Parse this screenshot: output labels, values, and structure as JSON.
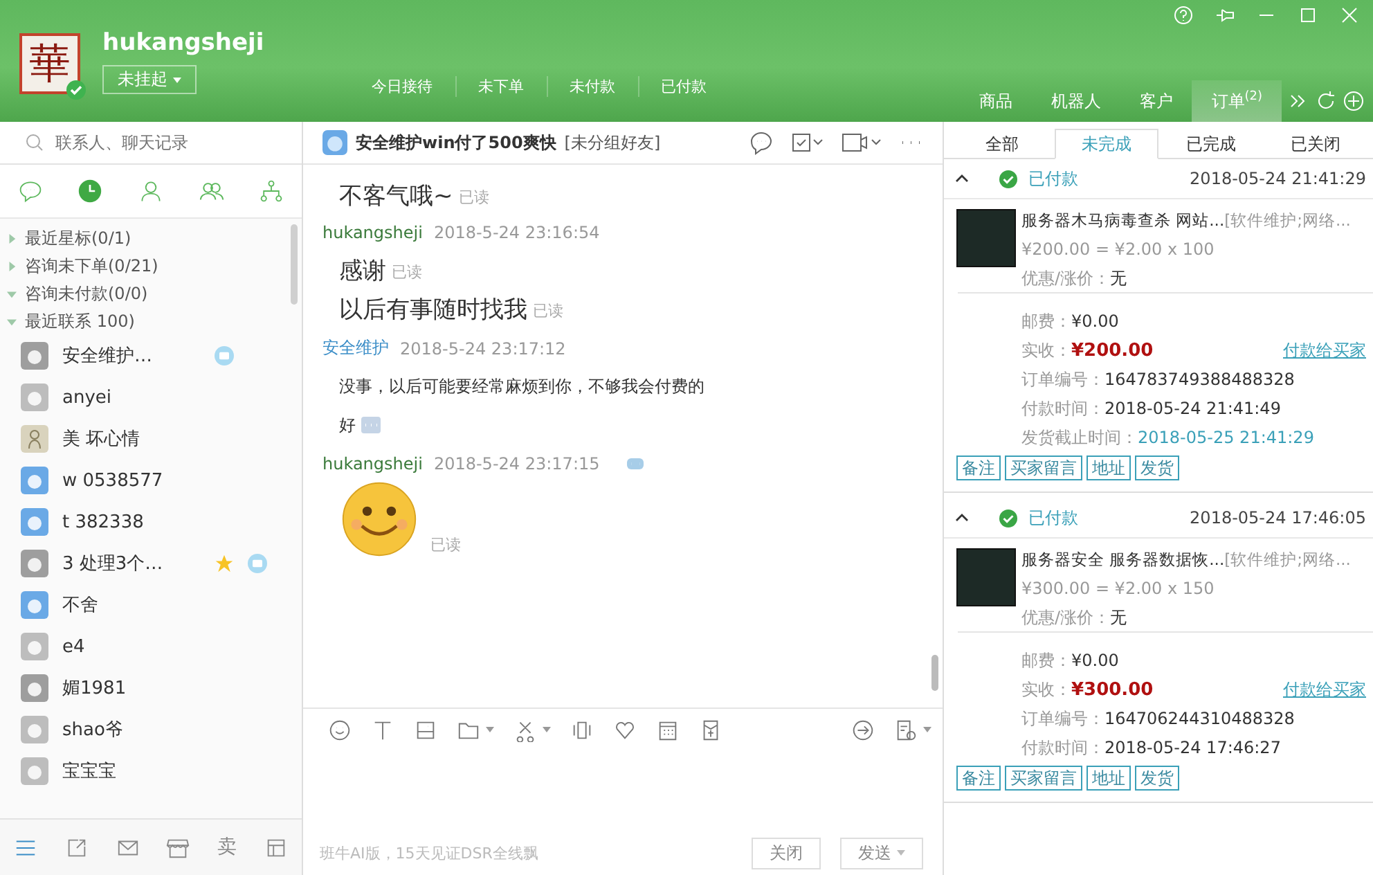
{
  "header": {
    "logo_text": "華",
    "username": "hukangsheji",
    "status": "未挂起",
    "stats": [
      "今日接待",
      "未下单",
      "未付款",
      "已付款"
    ],
    "nav": [
      {
        "label": "商品",
        "selected": false
      },
      {
        "label": "机器人",
        "selected": false
      },
      {
        "label": "客户",
        "selected": false
      },
      {
        "label": "订单",
        "badge": "(2)",
        "selected": true
      }
    ]
  },
  "sidebar": {
    "search": {
      "placeholder": "联系人、聊天记录"
    },
    "tabs": [
      {
        "selected": false
      },
      {
        "selected": true
      },
      {
        "selected": false
      },
      {
        "selected": false
      },
      {
        "selected": false
      }
    ],
    "groups": [
      {
        "label": "最近星标(0/1)",
        "expanded": false
      },
      {
        "label": "咨询未下单(0/21)",
        "expanded": false
      },
      {
        "label": "咨询未付款(0/0)",
        "expanded": true
      },
      {
        "label": "最近联系 100)",
        "expanded": true,
        "children": [
          {
            "name": "安全维护…",
            "kind": "robot",
            "starred": false,
            "unread": true
          },
          {
            "name": "anyei",
            "kind": "gray",
            "starred": false,
            "unread": false
          },
          {
            "name": "美 坏心情",
            "kind": "photo",
            "starred": false,
            "unread": false
          },
          {
            "name": "w 0538577",
            "kind": "blue",
            "starred": false,
            "unread": false
          },
          {
            "name": "t 382338",
            "kind": "blue",
            "starred": false,
            "unread": false
          },
          {
            "name": "3 处理3个…",
            "kind": "robot",
            "starred": true,
            "unread": true
          },
          {
            "name": "不舍",
            "kind": "blue",
            "starred": false,
            "unread": false
          },
          {
            "name": "e4",
            "kind": "gray",
            "starred": false,
            "unread": false
          },
          {
            "name": "媚1981",
            "kind": "robot",
            "starred": false,
            "unread": false
          },
          {
            "name": "shao爷",
            "kind": "gray",
            "starred": false,
            "unread": false
          },
          {
            "name": "宝宝宝",
            "kind": "gray",
            "starred": false,
            "unread": false
          }
        ]
      }
    ],
    "bottom_label": "卖"
  },
  "chat": {
    "title": "安全维护win付了500爽快",
    "group": "[未分组好友]",
    "messages": [
      {
        "kind": "self",
        "robot": false,
        "lines": [
          {
            "kind": "text",
            "text": "不客气哦~",
            "read": "已读"
          }
        ]
      },
      {
        "kind": "self",
        "sender": "hukangsheji",
        "time": "2018-5-24 23:16:54",
        "robot": false,
        "lines": [
          {
            "kind": "text",
            "text": "感谢",
            "read": "已读"
          },
          {
            "kind": "text",
            "text": "以后有事随时找我",
            "read": "已读"
          }
        ]
      },
      {
        "kind": "other",
        "sender": "安全维护",
        "time": "2018-5-24 23:17:12",
        "robot": false,
        "lines": [
          {
            "kind": "small",
            "text": "没事，以后可能要经常麻烦到你，不够我会付费的"
          },
          {
            "kind": "small",
            "text": "好",
            "more": true
          }
        ]
      },
      {
        "kind": "self",
        "sender": "hukangsheji",
        "time": "2018-5-24 23:17:15",
        "robot": true,
        "lines": [
          {
            "kind": "emoji",
            "read": "已读"
          }
        ]
      }
    ],
    "footer_note": "班牛AI版，15天见证DSR全线飘",
    "close_button": "关闭",
    "send_button": "发送"
  },
  "orders": {
    "tabs": [
      {
        "label": "全部",
        "selected": false
      },
      {
        "label": "未完成",
        "selected": true
      },
      {
        "label": "已完成",
        "selected": false
      },
      {
        "label": "已关闭",
        "selected": false
      }
    ],
    "items": [
      {
        "expanded": true,
        "status": "已付款",
        "time": "2018-05-24 21:41:29",
        "title": "服务器木马病毒查杀 网站...",
        "category": "[软件维护;网络...",
        "price": "¥200.00 = ¥2.00 x 100",
        "discount_label": "优惠/涨价：",
        "discount": "无",
        "rows": [
          {
            "label": "邮费：",
            "value": "¥0.00",
            "kind": "plain"
          },
          {
            "label": "实收：",
            "value": "¥200.00",
            "kind": "amount",
            "action": "付款给买家"
          },
          {
            "label": "订单编号：",
            "value": "164783749388488328",
            "kind": "plain"
          },
          {
            "label": "付款时间：",
            "value": "2018-05-24 21:41:49",
            "kind": "plain"
          },
          {
            "label": "发货截止时间：",
            "value": "2018-05-25 21:41:29",
            "kind": "deadline"
          }
        ],
        "buttons": [
          "备注",
          "买家留言",
          "地址",
          "发货"
        ]
      },
      {
        "expanded": true,
        "status": "已付款",
        "time": "2018-05-24 17:46:05",
        "title": "服务器安全 服务器数据恢...",
        "category": "[软件维护;网络...",
        "price": "¥300.00 = ¥2.00 x 150",
        "discount_label": "优惠/涨价：",
        "discount": "无",
        "rows": [
          {
            "label": "邮费：",
            "value": "¥0.00",
            "kind": "plain"
          },
          {
            "label": "实收：",
            "value": "¥300.00",
            "kind": "amount",
            "action": "付款给买家"
          },
          {
            "label": "订单编号：",
            "value": "164706244310488328",
            "kind": "plain"
          },
          {
            "label": "付款时间：",
            "value": "2018-05-24 17:46:27",
            "kind": "plain"
          }
        ],
        "buttons": [
          "备注",
          "买家留言",
          "地址",
          "发货"
        ]
      }
    ]
  }
}
